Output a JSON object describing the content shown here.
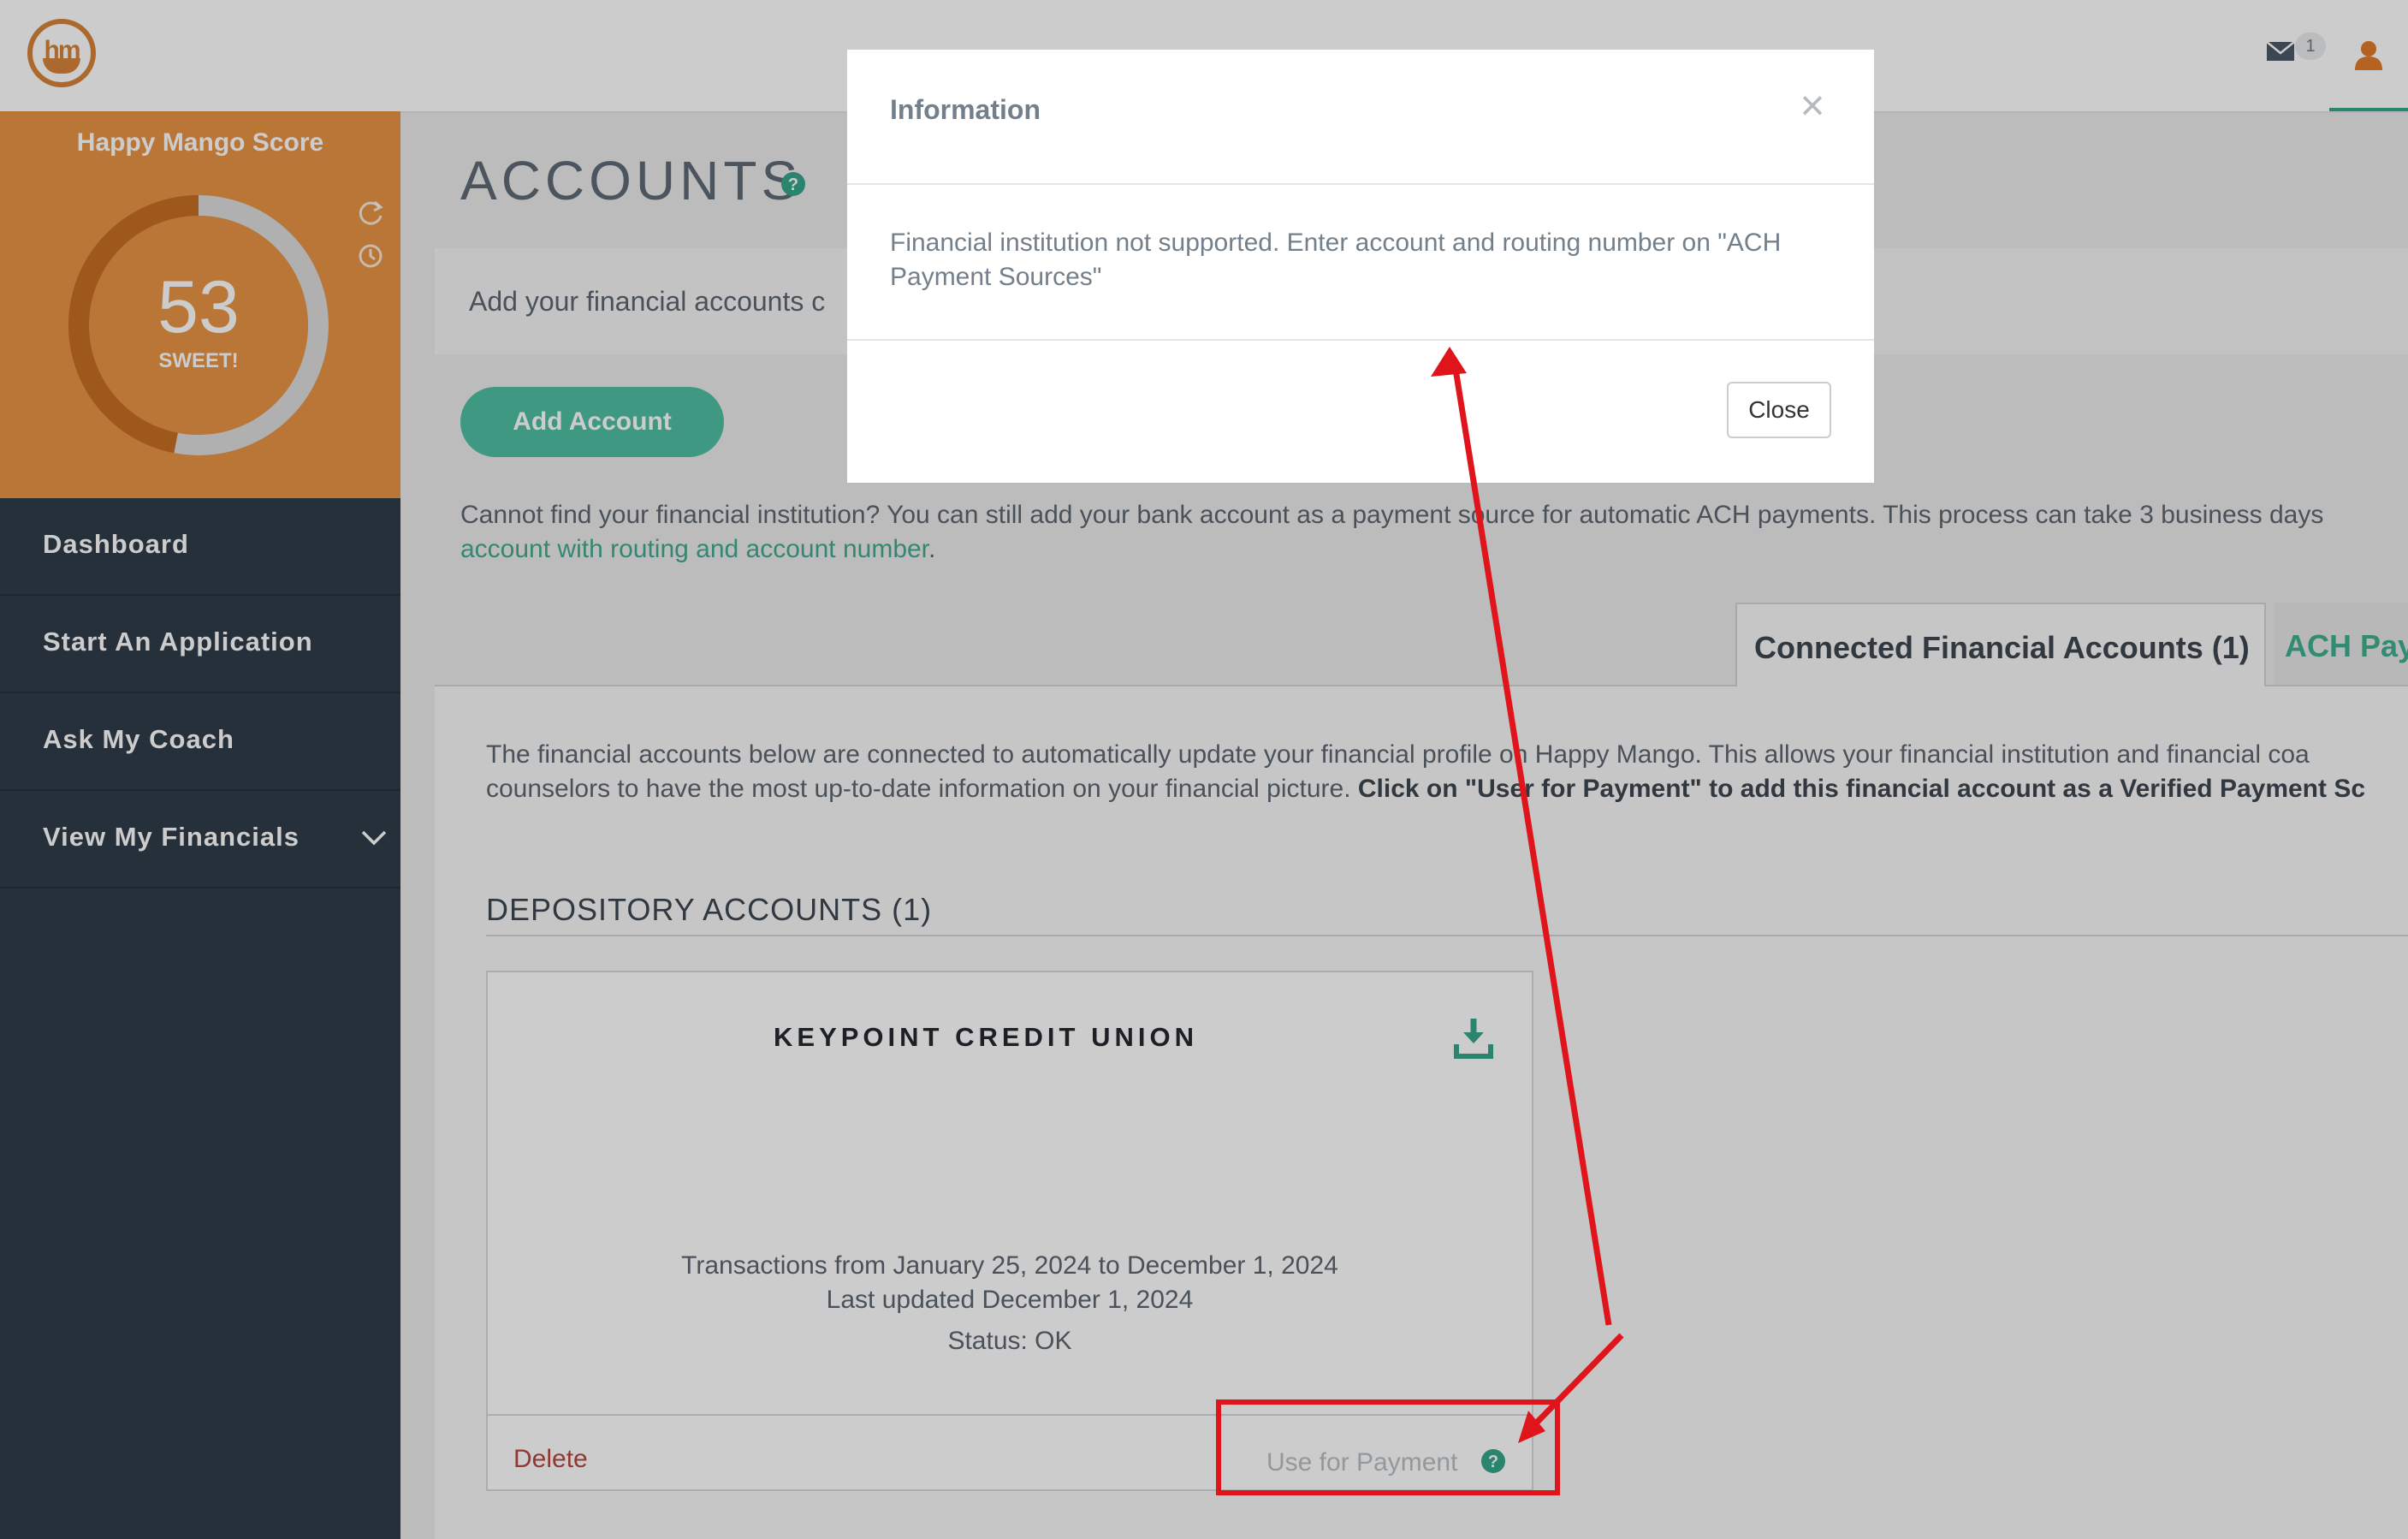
{
  "header": {
    "logo_text": "hm",
    "mail_count": "1"
  },
  "sidebar": {
    "score_title": "Happy Mango Score",
    "score_value": "53",
    "score_label": "SWEET!",
    "score_fraction": 0.53,
    "items": [
      {
        "label": "Dashboard"
      },
      {
        "label": "Start An Application"
      },
      {
        "label": "Ask My Coach"
      },
      {
        "label": "View My Financials"
      }
    ]
  },
  "main": {
    "title": "ACCOUNTS",
    "info_text": "Add your financial accounts c                                                                                                    ary charges.",
    "add_button": "Add Account",
    "cannot_find_text": "Cannot find your financial institution? You can still add your bank account as a payment source for automatic ACH payments. This process can take 3 business days",
    "manual_link": "account with routing and account number",
    "manual_link_suffix": ".",
    "tabs": [
      {
        "label": "Connected Financial Accounts (1)"
      },
      {
        "label": "ACH Pay"
      }
    ],
    "intro_line1": "The financial accounts below are connected to automatically update your financial profile on Happy Mango. This allows your financial institution and financial coa",
    "intro_line2_plain": "counselors to have the most up-to-date information on your financial picture. ",
    "intro_line2_bold": "Click on \"User for Payment\" to add this financial account as a Verified Payment Sc",
    "section_title": "DEPOSITORY ACCOUNTS (1)",
    "card": {
      "institution": "KEYPOINT CREDIT UNION",
      "transactions": "Transactions from January 25, 2024 to December 1, 2024",
      "last_updated": "Last updated December 1, 2024",
      "status": "Status: OK",
      "delete": "Delete",
      "use_for_payment": "Use for Payment"
    }
  },
  "modal": {
    "title": "Information",
    "close_x": "×",
    "body": "Financial institution not supported. Enter account and routing number on \"ACH Payment Sources\"",
    "close_button": "Close"
  },
  "colors": {
    "brand_orange": "#e89445",
    "accent_green": "#4fbfa2",
    "sidebar_dark": "#2f3c49",
    "annotation_red": "#e0141b"
  },
  "icons": [
    "mail-icon",
    "user-icon",
    "refresh-icon",
    "history-icon",
    "chevron-down-icon",
    "help-icon",
    "download-icon",
    "close-icon"
  ]
}
